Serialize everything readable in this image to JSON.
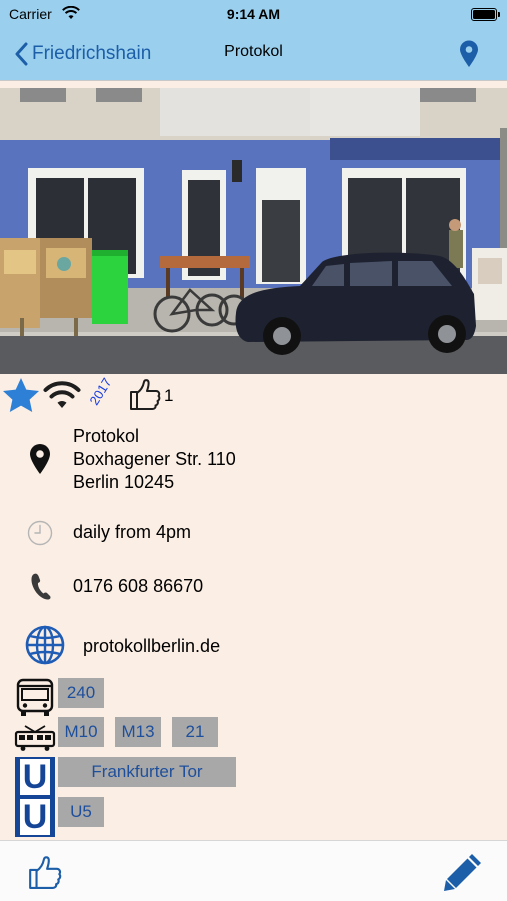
{
  "status_bar": {
    "carrier": "Carrier",
    "time": "9:14 AM"
  },
  "nav": {
    "back_label": "Friedrichshain",
    "title": "Protokol"
  },
  "badges": {
    "year": "2017",
    "like_count": "1"
  },
  "venue": {
    "name": "Protokol",
    "street": "Boxhagener Str. 110",
    "city": "Berlin 10245",
    "hours": "daily from 4pm",
    "phone": "0176 608 86670",
    "website": "protokollberlin.de"
  },
  "transit": {
    "bus": [
      "240"
    ],
    "tram": [
      "M10",
      "M13",
      "21"
    ],
    "ubahn_station": "Frankfurter Tor",
    "ubahn_lines": [
      "U5"
    ]
  },
  "colors": {
    "bar_background": "#9ad0ee",
    "page_background": "#fbeee4",
    "accent_blue": "#1d5ea8",
    "chip_background": "#a8a8a8",
    "ubahn_blue": "#154596"
  },
  "icons": [
    "wifi-icon",
    "battery-icon",
    "back-chevron-icon",
    "map-pin-icon",
    "star-icon",
    "wifi-icon",
    "thumbs-up-icon",
    "location-pin-icon",
    "clock-icon",
    "phone-icon",
    "globe-icon",
    "bus-icon",
    "tram-icon",
    "ubahn-icon",
    "pencil-icon"
  ]
}
